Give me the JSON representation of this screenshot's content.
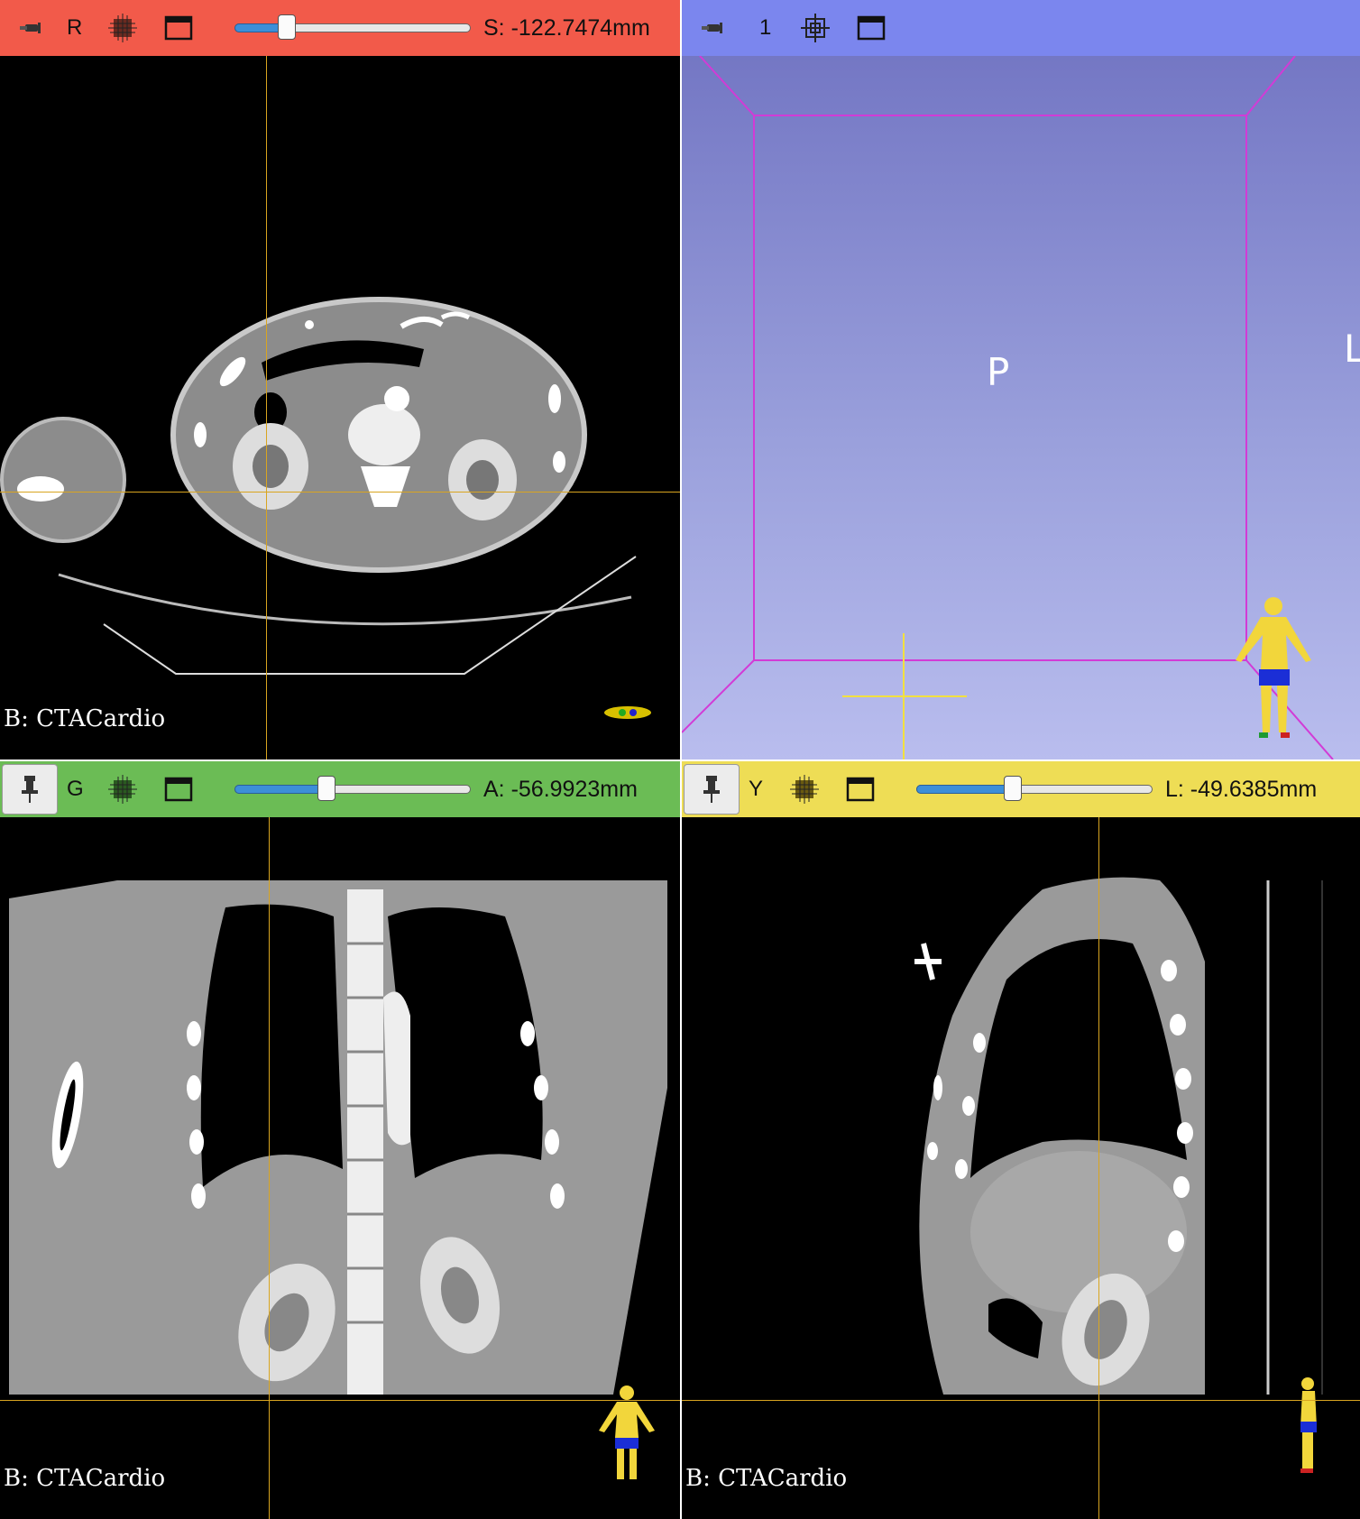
{
  "views": {
    "red": {
      "label": "R",
      "offset": "S: -122.7474mm",
      "slider_fraction": 0.22,
      "background_name": "B: CTACardio",
      "bar_color": "#f25a4a"
    },
    "threed": {
      "label": "1",
      "orientation_center": "P",
      "orientation_right": "L",
      "bar_color": "#7b86ee"
    },
    "green": {
      "label": "G",
      "offset": "A: -56.9923mm",
      "slider_fraction": 0.39,
      "background_name": "B: CTACardio",
      "bar_color": "#6bbc55"
    },
    "yellow": {
      "label": "Y",
      "offset": "L: -49.6385mm",
      "slider_fraction": 0.41,
      "background_name": "B: CTACardio",
      "bar_color": "#eedd55"
    }
  },
  "icons": {
    "pin": "pin-icon",
    "slice_options": "slice-options-icon",
    "center_3d": "center-view-icon",
    "window": "maximize-view-icon",
    "orientation_marker": "human-figure-icon"
  },
  "colors": {
    "crosshair": "#d9a520",
    "bounding_box": "#d23bd6",
    "slider_fill": "#3d8fd8"
  }
}
